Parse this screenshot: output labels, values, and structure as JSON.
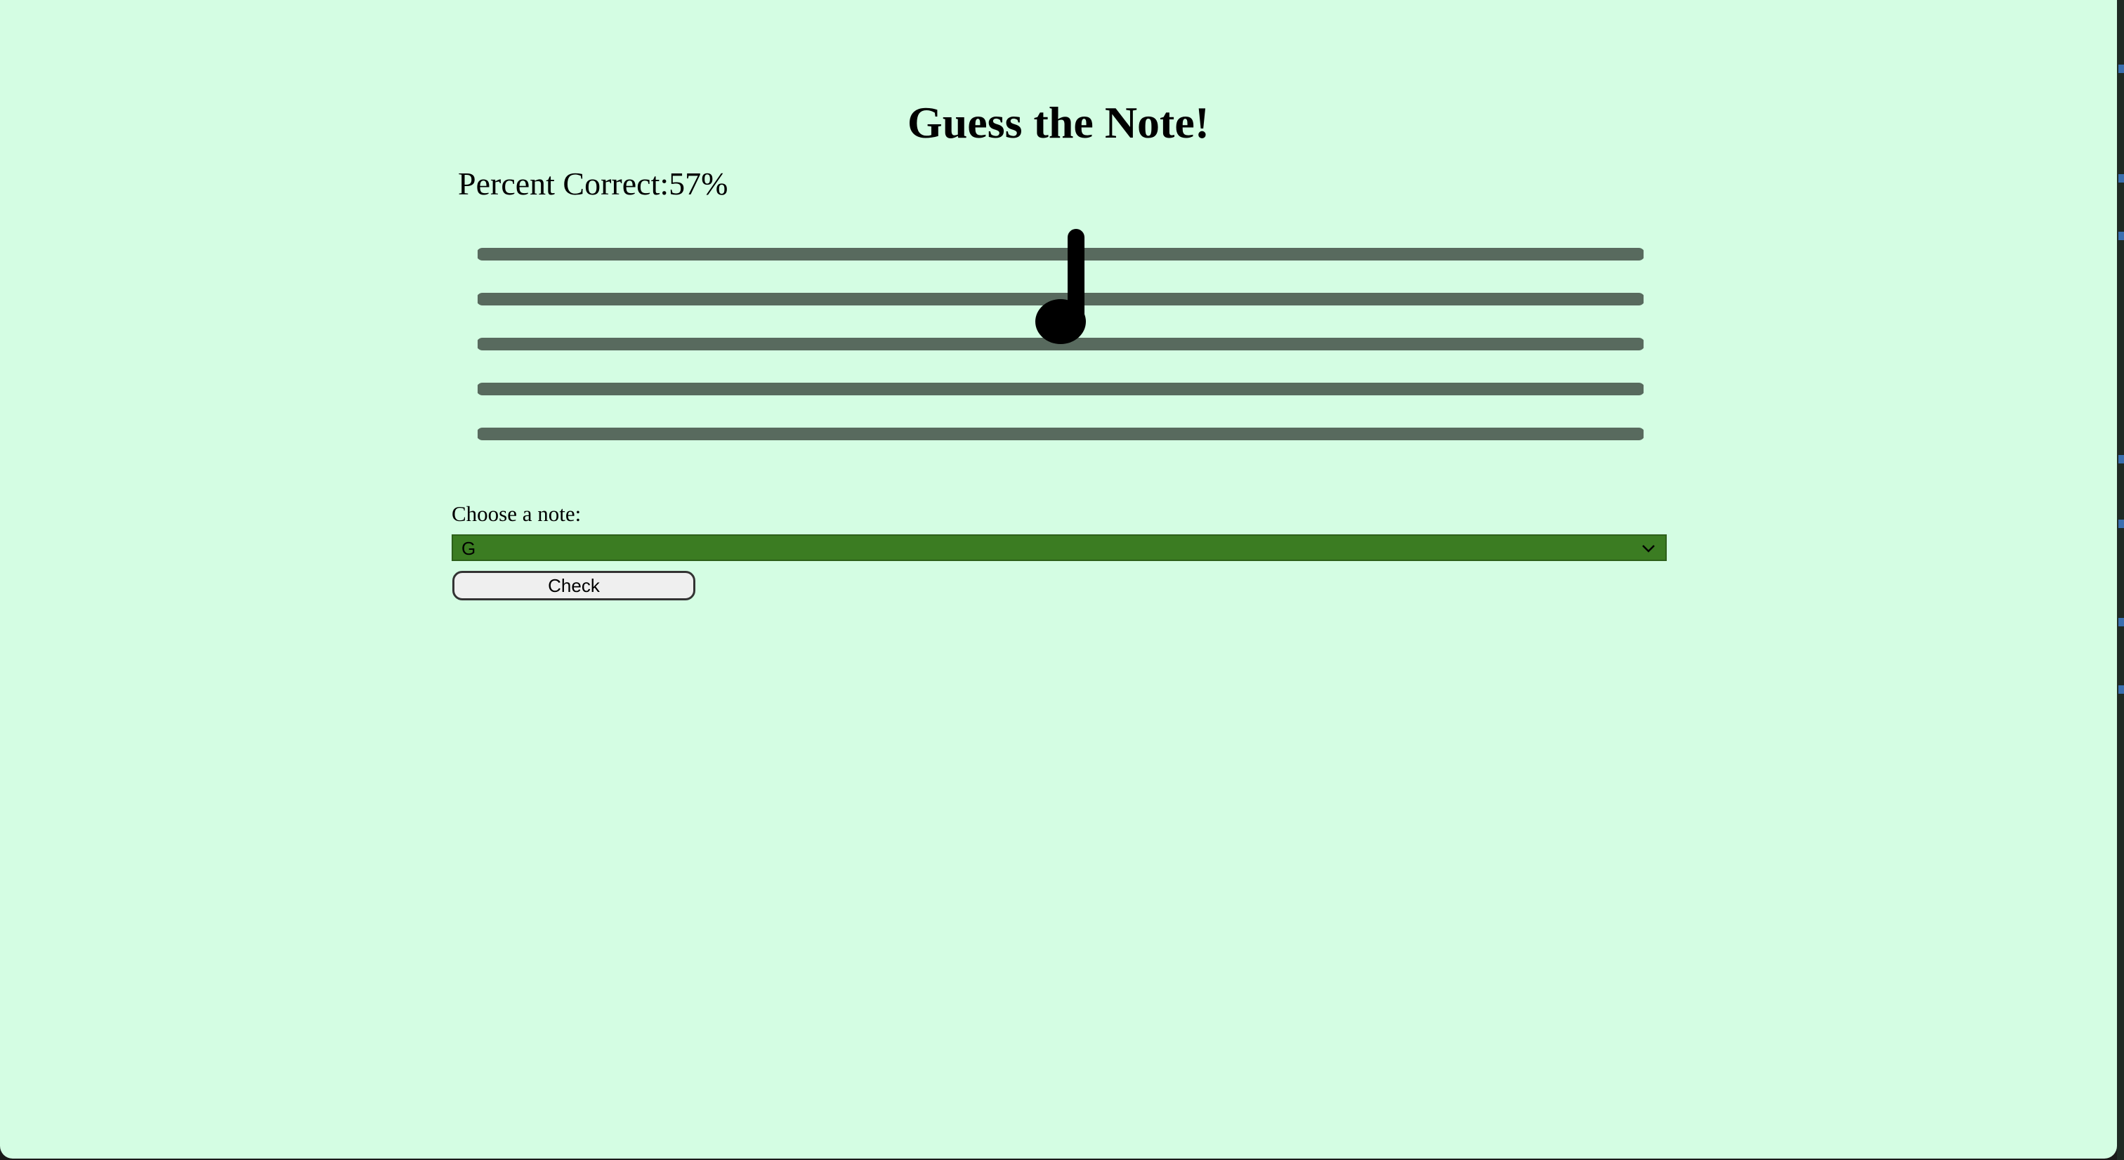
{
  "page": {
    "title": "Guess the Note!",
    "score_label": "Percent Correct:",
    "score_value": "57%"
  },
  "staff": {
    "line_count": 5,
    "line_color": "#586a5e",
    "note_color": "#000000",
    "note": "quarter-note-icon"
  },
  "form": {
    "label": "Choose a note:",
    "selected_note": "G",
    "select_color": "#3b7c22",
    "check_label": "Check"
  },
  "colors": {
    "background": "#d4fde3"
  }
}
